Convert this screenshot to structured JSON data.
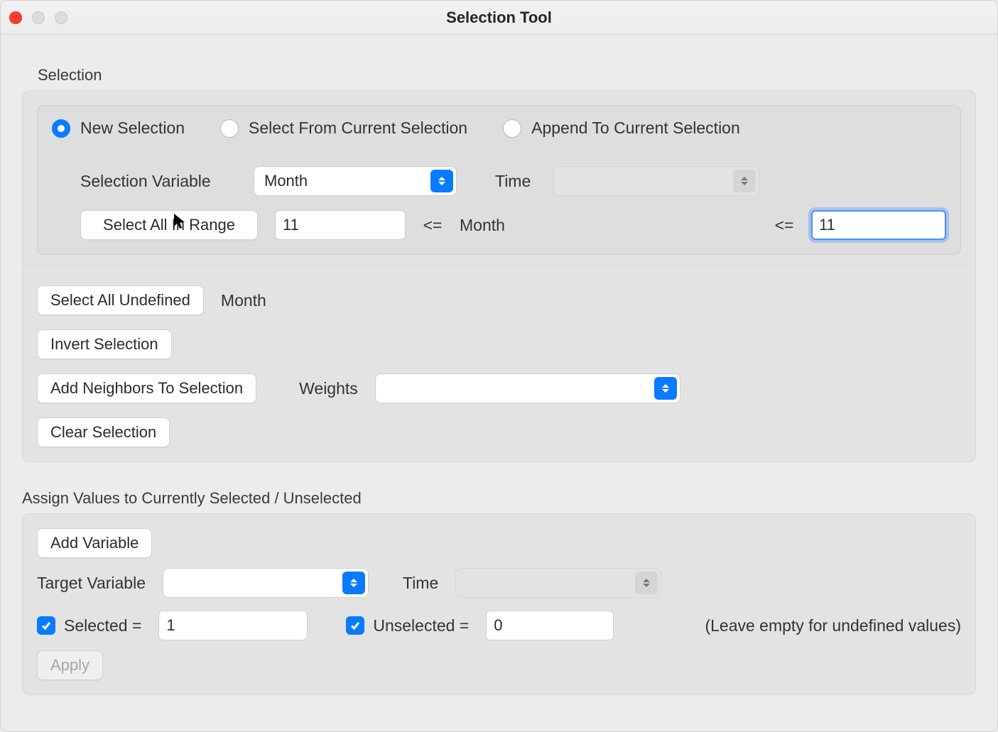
{
  "window": {
    "title": "Selection Tool"
  },
  "selection": {
    "group_label": "Selection",
    "radios": {
      "new": "New Selection",
      "from_current": "Select From Current Selection",
      "append": "Append To Current Selection"
    },
    "variable_label": "Selection Variable",
    "variable_value": "Month",
    "time_label": "Time",
    "time_value": "",
    "range_button": "Select All In Range",
    "range_lower": "11",
    "range_op_left": "<=",
    "range_mid_label": "Month",
    "range_op_right": "<=",
    "range_upper": "11",
    "undefined_button": "Select All Undefined",
    "undefined_var": "Month",
    "invert_button": "Invert Selection",
    "neighbors_button": "Add Neighbors To Selection",
    "weights_label": "Weights",
    "weights_value": "",
    "clear_button": "Clear Selection"
  },
  "assign": {
    "group_label": "Assign Values to Currently Selected / Unselected",
    "add_variable": "Add Variable",
    "target_label": "Target Variable",
    "target_value": "",
    "time_label": "Time",
    "time_value": "",
    "selected_label": "Selected =",
    "selected_value": "1",
    "unselected_label": "Unselected =",
    "unselected_value": "0",
    "hint": "(Leave empty for undefined values)",
    "apply": "Apply"
  }
}
